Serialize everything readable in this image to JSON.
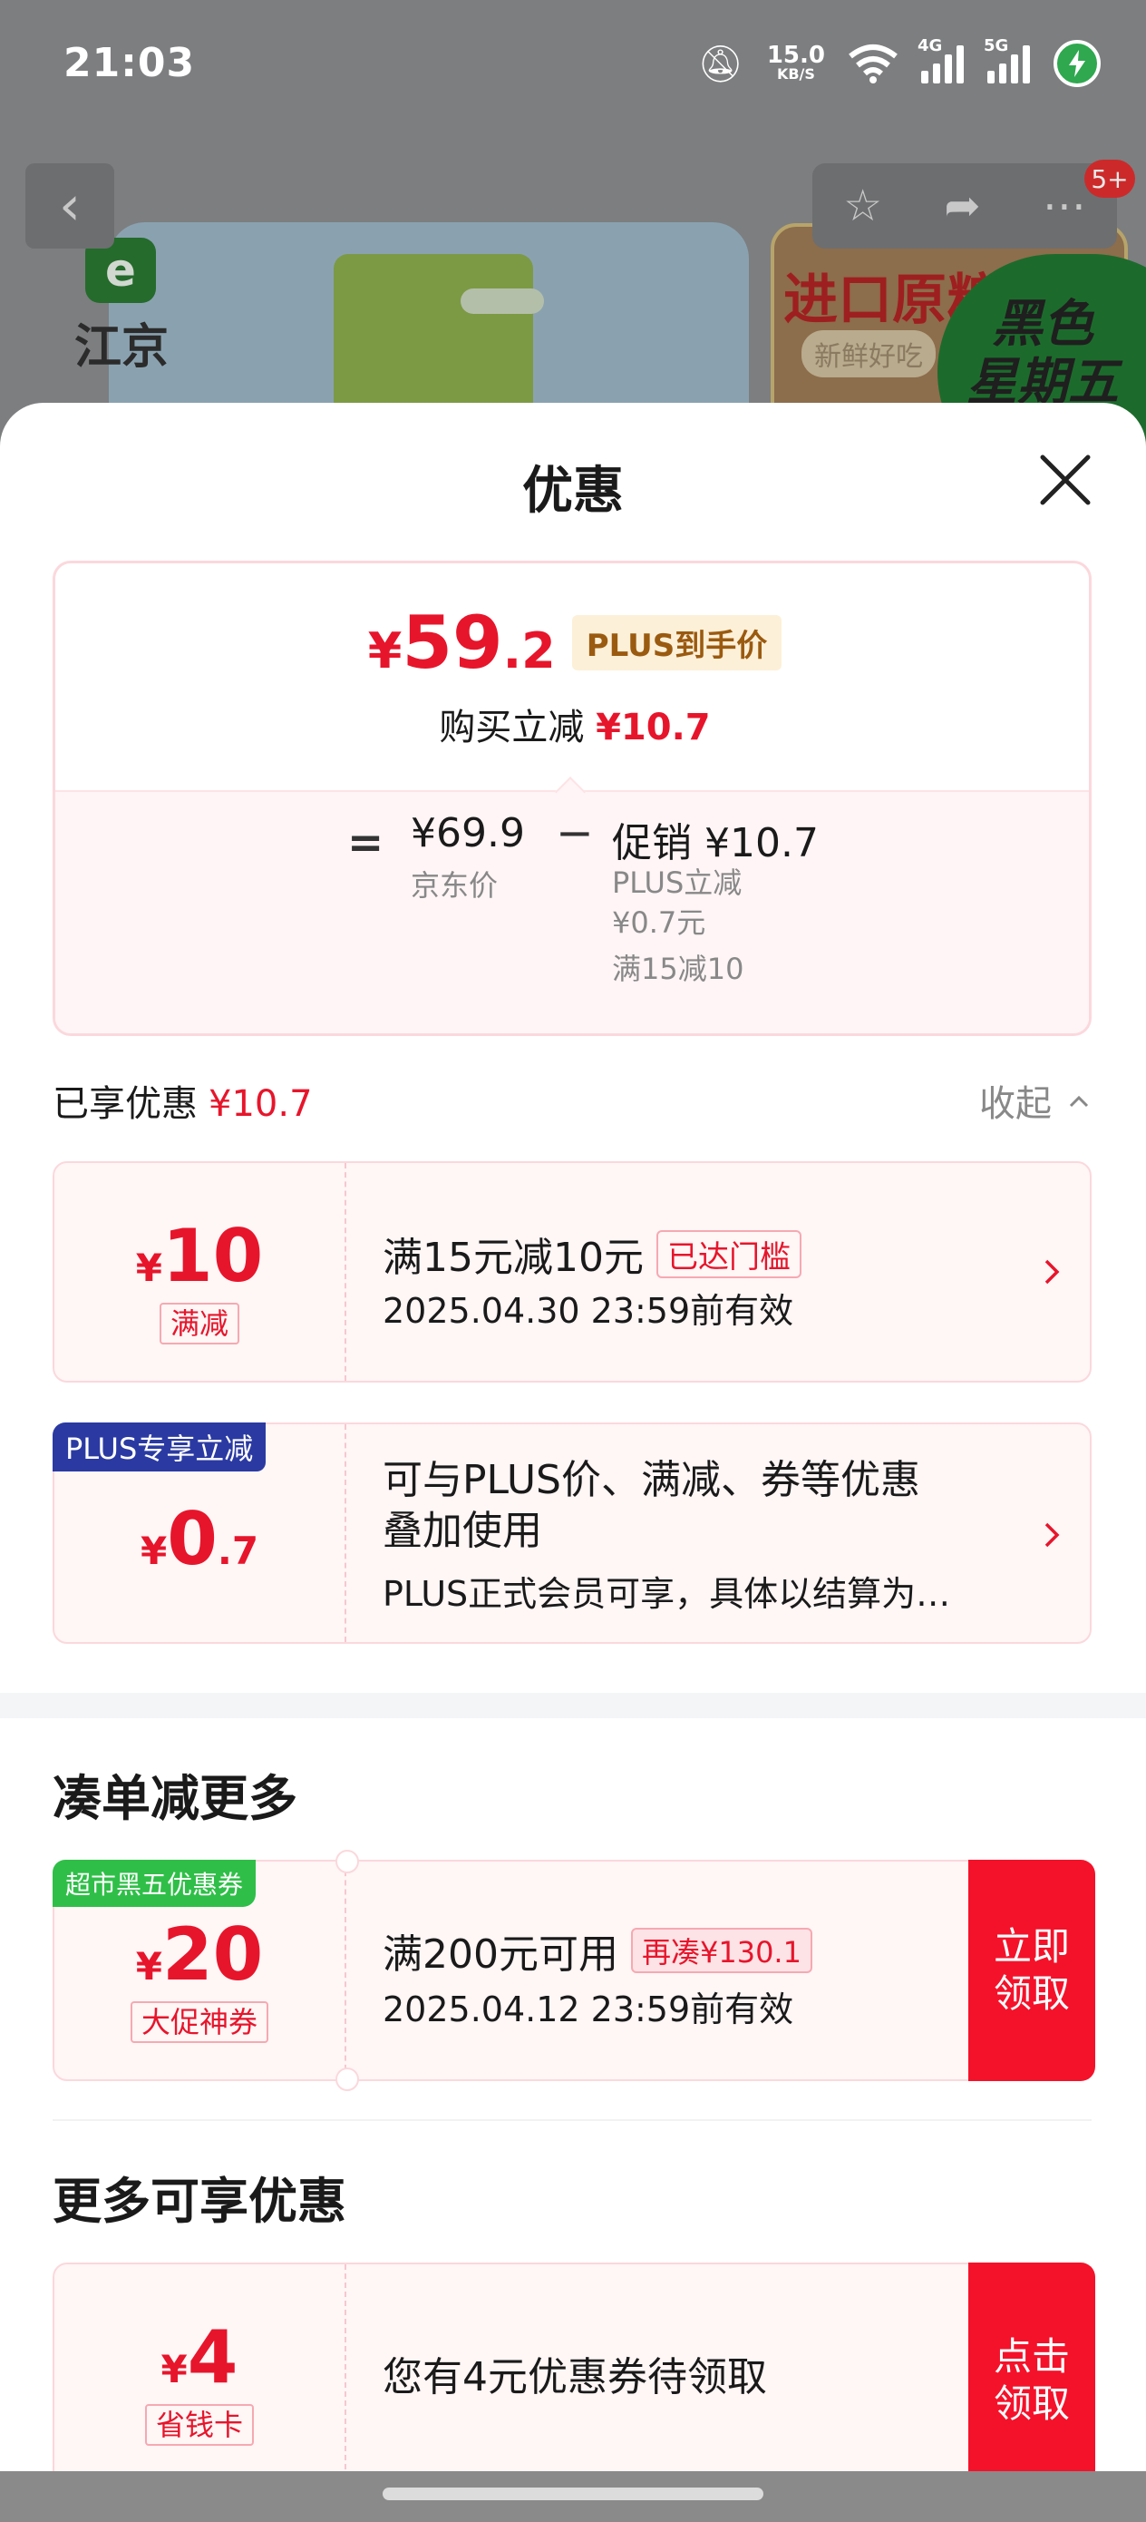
{
  "status_bar": {
    "time": "21:03",
    "net_speed": "15.0",
    "net_unit": "KB/S",
    "sig1": "4G",
    "sig2": "5G"
  },
  "background": {
    "badge": "5+",
    "brand_logo_char": "e",
    "brand_name": "江京",
    "promo_title": "进口原粮",
    "promo_sub": "新鲜好吃",
    "promo_badge": "黑色\n星期五"
  },
  "sheet": {
    "title": "优惠",
    "price_box": {
      "yen": "¥",
      "price_int": "59",
      "price_dec": ".2",
      "tag": "PLUS到手价",
      "instant_label": "购买立减",
      "instant_value": "¥10.7",
      "equals": "=",
      "orig_price": "¥69.9",
      "orig_label": "京东价",
      "minus": "−",
      "promo_label": "促销 ¥10.7",
      "promo_detail_1": "PLUS立减",
      "promo_detail_2": "¥0.7元",
      "promo_detail_3": "满15减10"
    },
    "enjoyed": {
      "label": "已享优惠",
      "value": "¥10.7",
      "collapse": "收起"
    },
    "coupons": [
      {
        "yen": "¥",
        "num": "10",
        "dec": "",
        "tag": "满减",
        "text": "满15元减10元",
        "badge": "已达门槛",
        "sub": "2025.04.30 23:59前有效"
      },
      {
        "ribbon": "PLUS专享立减",
        "yen": "¥",
        "num": "0",
        "dec": ".7",
        "text_line1": "可与PLUS价、满减、券等优惠",
        "text_line2": "叠加使用",
        "sub": "PLUS正式会员可享，具体以结算为…"
      }
    ],
    "more_section": {
      "title": "凑单减更多",
      "coupon": {
        "ribbon": "超市黑五优惠券",
        "yen": "¥",
        "num": "20",
        "tag": "大促神券",
        "text": "满200元可用",
        "badge": "再凑¥130.1",
        "sub": "2025.04.12 23:59前有效",
        "button": "立即\n领取"
      }
    },
    "extra_section": {
      "title": "更多可享优惠",
      "coupon": {
        "yen": "¥",
        "num": "4",
        "tag": "省钱卡",
        "text": "您有4元优惠券待领取",
        "button": "点击\n领取"
      }
    }
  },
  "colors": {
    "accent_red": "#e7152b",
    "plus_blue": "#2b3aa2",
    "ribbon_green": "#2fbf48"
  }
}
